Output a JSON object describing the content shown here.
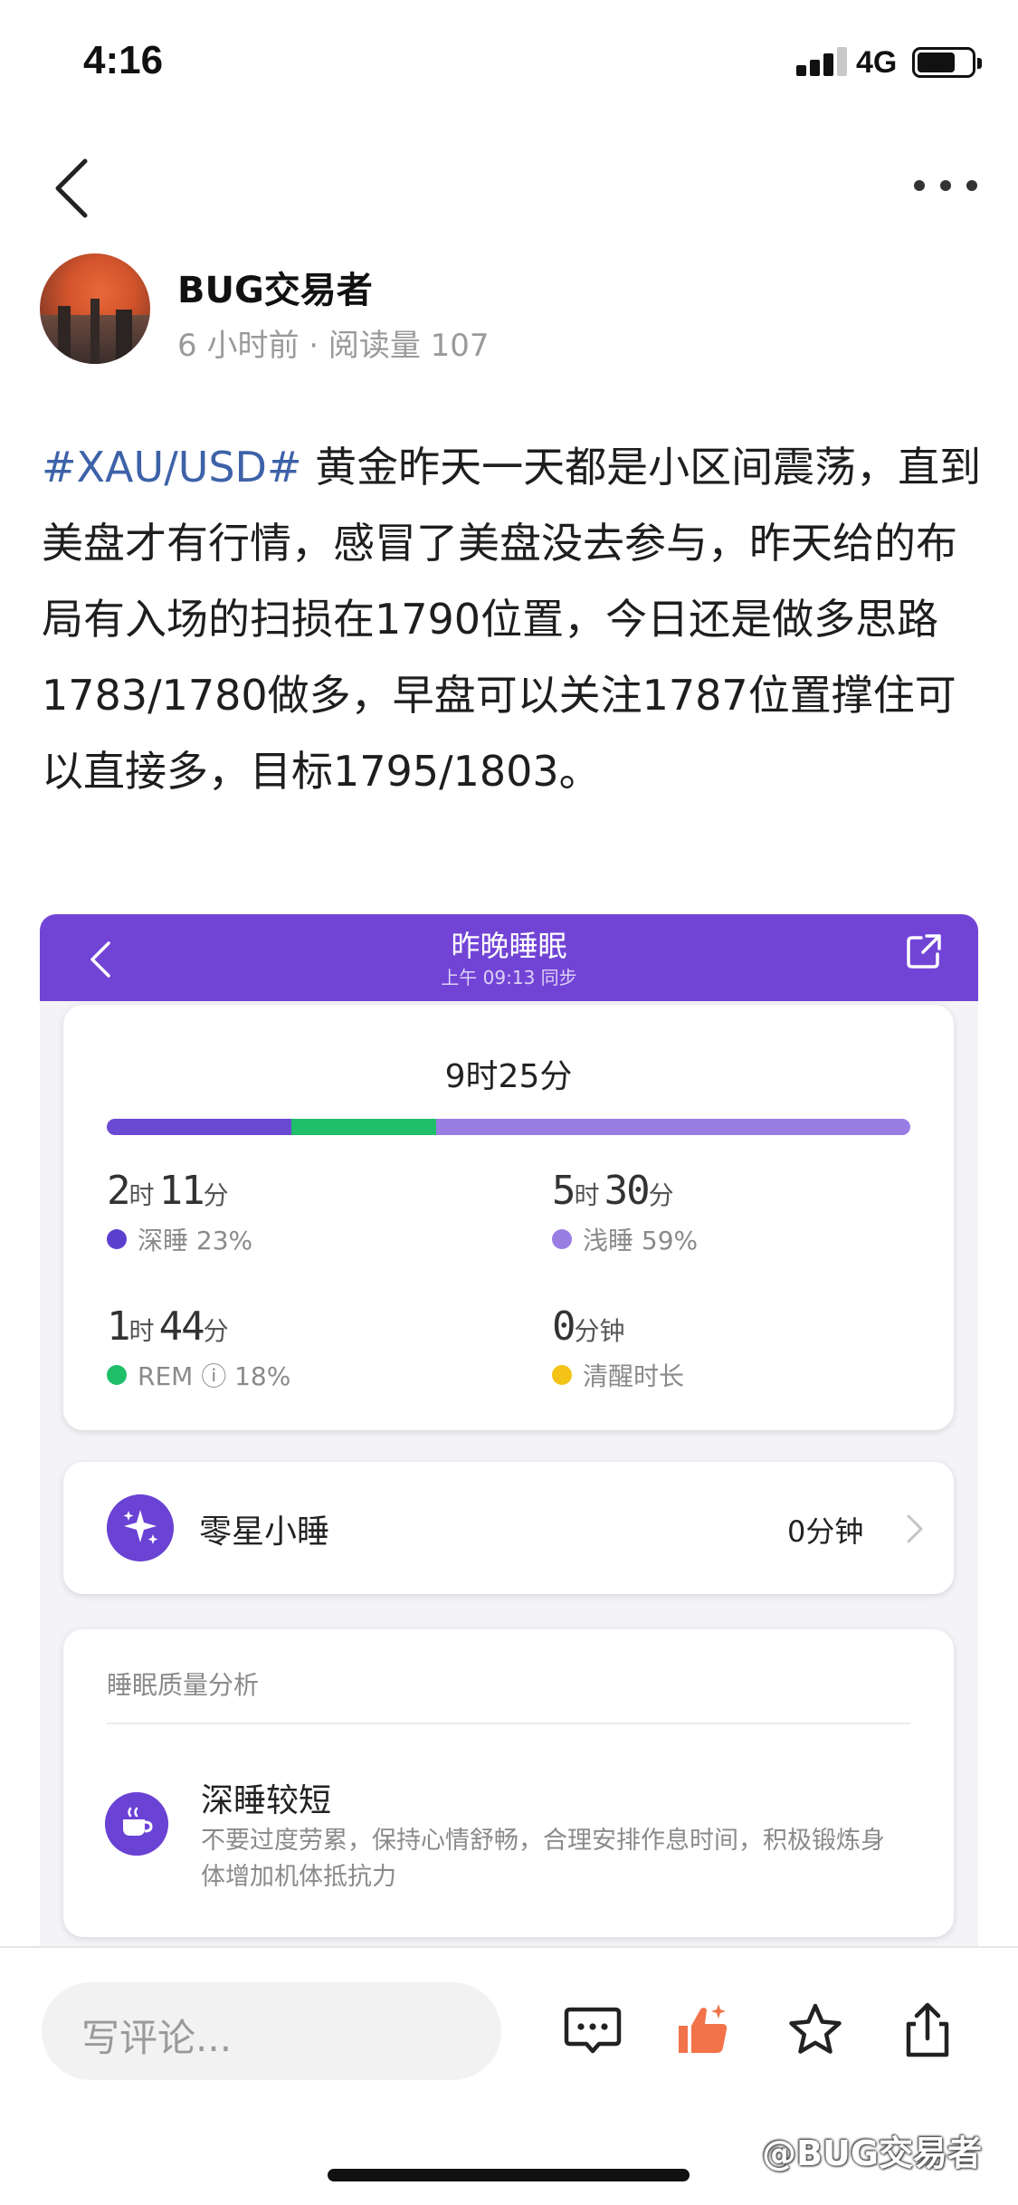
{
  "status_bar": {
    "time": "4:16",
    "network": "4G",
    "signal_bars": 3,
    "signal_bars_total": 4,
    "battery_level": 0.7
  },
  "nav": {
    "back_icon": "chevron-left-icon",
    "more_icon": "more-dots-icon"
  },
  "author": {
    "name": "BUG交易者",
    "meta": "6 小时前 · 阅读量 107"
  },
  "post": {
    "hashtag": "#XAU/USD#",
    "body": " 黄金昨天一天都是小区间震荡，直到美盘才有行情，感冒了美盘没去参与，昨天给的布局有入场的扫损在1790位置，今日还是做多思路1783/1780做多，早盘可以关注1787位置撑住可以直接多，目标1795/1803。"
  },
  "embed": {
    "header": {
      "title": "昨晚睡眠",
      "subtitle": "上午 09:13 同步",
      "accent": "#7244d6"
    },
    "summary": {
      "total": "9时25分",
      "bar_fractions": {
        "deep": 0.23,
        "rem": 0.18,
        "light": 0.59
      },
      "stats": [
        {
          "hours": "2",
          "h_unit": "时",
          "mins": "11",
          "m_unit": "分",
          "label": "深睡 23%",
          "color": "#5b3fcf"
        },
        {
          "hours": "5",
          "h_unit": "时",
          "mins": "30",
          "m_unit": "分",
          "label": "浅睡 59%",
          "color": "#9a7de3"
        },
        {
          "hours": "1",
          "h_unit": "时",
          "mins": "44",
          "m_unit": "分",
          "label": "REM ⓘ 18%",
          "color": "#1fbf6a"
        },
        {
          "hours": "0",
          "h_unit": "分钟",
          "mins": "",
          "m_unit": "",
          "label": "清醒时长",
          "color": "#f3c318"
        }
      ]
    },
    "nap": {
      "title": "零星小睡",
      "value": "0分钟"
    },
    "quality": {
      "heading": "睡眠质量分析",
      "title": "深睡较短",
      "description": "不要过度劳累，保持心情舒畅，合理安排作息时间，积极锻炼身体增加机体抵抗力"
    }
  },
  "bottom_bar": {
    "comment_placeholder": "写评论...",
    "icons": [
      "comment-icon",
      "like-icon",
      "star-icon",
      "share-icon"
    ],
    "like_color": "#f2734a"
  },
  "watermark": "@BUG交易者"
}
